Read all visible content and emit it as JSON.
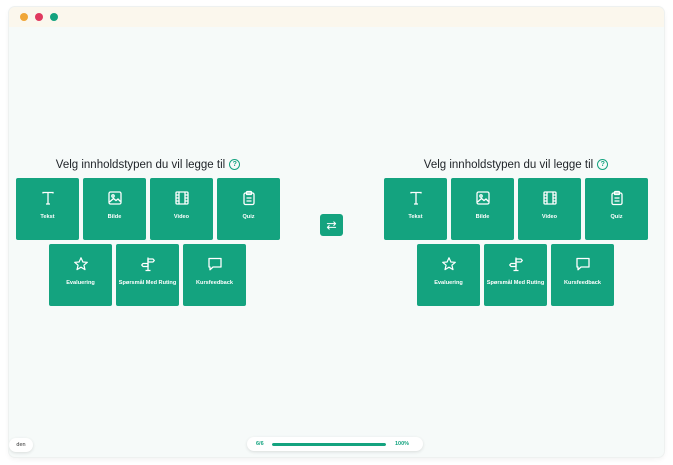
{
  "colors": {
    "accent": "#14a37f",
    "titlebar": "#fbf7ed",
    "canvas": "#f6faf9"
  },
  "window_controls": [
    "close",
    "minimize",
    "maximize"
  ],
  "left_panel": {
    "title": "Velg innholdstypen du vil legge til",
    "help_icon": "?",
    "tiles": [
      {
        "label": "Tekst",
        "icon": "text-icon"
      },
      {
        "label": "Bilde",
        "icon": "image-icon"
      },
      {
        "label": "Video",
        "icon": "film-icon"
      },
      {
        "label": "Quiz",
        "icon": "clipboard-icon"
      },
      {
        "label": "Evaluering",
        "icon": "star-icon"
      },
      {
        "label": "Spørsmål Med Ruting",
        "icon": "signpost-icon"
      },
      {
        "label": "Kursfeedback",
        "icon": "message-icon"
      }
    ]
  },
  "right_panel": {
    "title": "Velg innholdstypen du vil legge til",
    "help_icon": "?",
    "tiles": [
      {
        "label": "Tekst",
        "icon": "text-icon"
      },
      {
        "label": "Bilde",
        "icon": "image-icon"
      },
      {
        "label": "Video",
        "icon": "film-icon"
      },
      {
        "label": "Quiz",
        "icon": "clipboard-icon"
      },
      {
        "label": "Evaluering",
        "icon": "star-icon"
      },
      {
        "label": "Spørsmål Med Ruting",
        "icon": "signpost-icon"
      },
      {
        "label": "Kursfeedback",
        "icon": "message-icon"
      }
    ]
  },
  "swap_button": {
    "icon": "swap-arrows-icon"
  },
  "progress": {
    "count": "6/6",
    "percent_label": "100%",
    "fraction": 1.0
  },
  "language_chip": {
    "label": "den"
  }
}
